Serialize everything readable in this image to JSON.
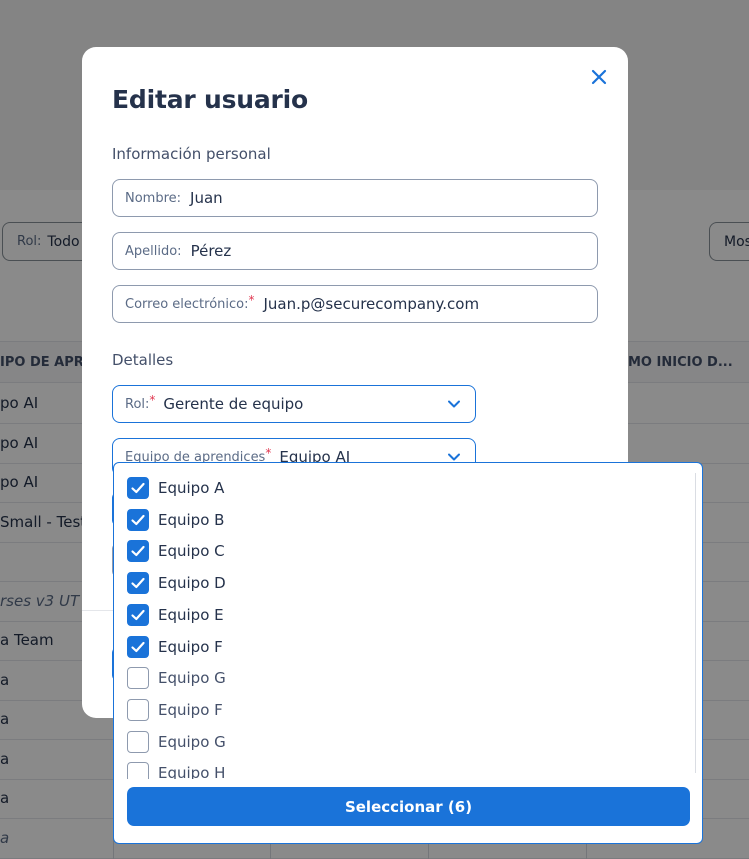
{
  "background": {
    "filters": {
      "role_label": "Rol:",
      "role_value": "Todo",
      "more_label": "Mos"
    },
    "table": {
      "headers": [
        "IPO DE APRE",
        "MO INICIO D..."
      ],
      "rows": [
        {
          "text": "po AI",
          "italic": false
        },
        {
          "text": "po AI",
          "italic": false
        },
        {
          "text": "po AI",
          "italic": false
        },
        {
          "text": "Small - Test",
          "italic": false
        },
        {
          "text": "",
          "italic": false
        },
        {
          "text": "rses v3 UT",
          "italic": true
        },
        {
          "text": "a Team",
          "italic": false
        },
        {
          "text": "a",
          "italic": false
        },
        {
          "text": "a",
          "italic": false
        },
        {
          "text": "a",
          "italic": false
        },
        {
          "text": "a",
          "italic": false
        },
        {
          "text": "a",
          "italic": true
        }
      ]
    }
  },
  "modal": {
    "title": "Editar usuario",
    "close_icon": "close-icon",
    "personal_section": "Información personal",
    "first_name": {
      "label": "Nombre:",
      "value": "Juan"
    },
    "last_name": {
      "label": "Apellido:",
      "value": "Pérez"
    },
    "email": {
      "label": "Correo electrónico:",
      "required": "*",
      "value": "Juan.p@securecompany.com"
    },
    "details_section": "Detalles",
    "role": {
      "label": "Rol:",
      "required": "*",
      "value": "Gerente de equipo"
    },
    "learner_team": {
      "label": "Equipo de aprendices",
      "required": "*",
      "value": "Equipo AI"
    }
  },
  "dropdown": {
    "options": [
      {
        "label": "Equipo A",
        "checked": true
      },
      {
        "label": "Equipo B",
        "checked": true
      },
      {
        "label": "Equipo C",
        "checked": true
      },
      {
        "label": "Equipo D",
        "checked": true
      },
      {
        "label": "Equipo E",
        "checked": true
      },
      {
        "label": "Equipo F",
        "checked": true
      },
      {
        "label": "Equipo G",
        "checked": false
      },
      {
        "label": "Equipo F",
        "checked": false
      },
      {
        "label": "Equipo G",
        "checked": false
      },
      {
        "label": "Equipo H",
        "checked": false
      }
    ],
    "select_button": "Seleccionar (6)"
  },
  "colors": {
    "accent": "#1a73d9",
    "text": "#25324b",
    "required": "#e0364f",
    "overlay": "rgba(0,0,0,0.46)"
  }
}
